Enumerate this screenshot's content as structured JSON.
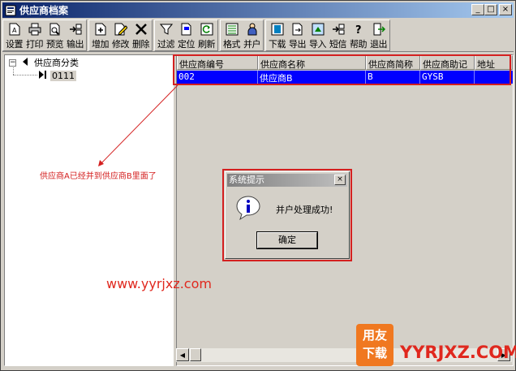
{
  "window": {
    "title": "供应商档案",
    "controls": [
      "_",
      "□",
      "×"
    ]
  },
  "toolbar": {
    "groups": [
      [
        {
          "label": "设置",
          "icon": "settings-doc-icon"
        },
        {
          "label": "打印",
          "icon": "printer-icon"
        },
        {
          "label": "预览",
          "icon": "preview-icon"
        },
        {
          "label": "输出",
          "icon": "export-icon"
        }
      ],
      [
        {
          "label": "增加",
          "icon": "add-doc-icon"
        },
        {
          "label": "修改",
          "icon": "edit-icon"
        },
        {
          "label": "删除",
          "icon": "delete-icon"
        }
      ],
      [
        {
          "label": "过滤",
          "icon": "filter-icon"
        },
        {
          "label": "定位",
          "icon": "locate-icon"
        },
        {
          "label": "刷新",
          "icon": "refresh-icon"
        }
      ],
      [
        {
          "label": "格式",
          "icon": "format-icon"
        },
        {
          "label": "并户",
          "icon": "merge-icon"
        }
      ],
      [
        {
          "label": "下载",
          "icon": "download-icon"
        },
        {
          "label": "导出",
          "icon": "export-out-icon"
        },
        {
          "label": "导入",
          "icon": "import-icon"
        },
        {
          "label": "短信",
          "icon": "sms-icon"
        },
        {
          "label": "帮助",
          "icon": "help-icon"
        },
        {
          "label": "退出",
          "icon": "exit-icon"
        }
      ]
    ]
  },
  "tree": {
    "root_label": "供应商分类",
    "child_label": "0111"
  },
  "grid": {
    "columns": [
      "供应商编号",
      "供应商名称",
      "供应商简称",
      "供应商助记",
      "地址"
    ],
    "rows": [
      [
        "002",
        "供应商B",
        "B",
        "GYSB",
        ""
      ]
    ]
  },
  "dialog": {
    "title": "系统提示",
    "close": "×",
    "message": "并户处理成功!",
    "ok_label": "确定"
  },
  "annotation": {
    "text": "供应商A已经并到供应商B里面了",
    "color": "#d42020"
  },
  "watermark": {
    "url": "www.yyrjxz.com",
    "logo_line1": "用友",
    "logo_line2": "下载",
    "site": "YYRJXZ.COM"
  },
  "colors": {
    "title_bar": "#0a246a",
    "selection": "#0000ff",
    "highlight_box": "#d42020",
    "face": "#d4d0c8"
  }
}
